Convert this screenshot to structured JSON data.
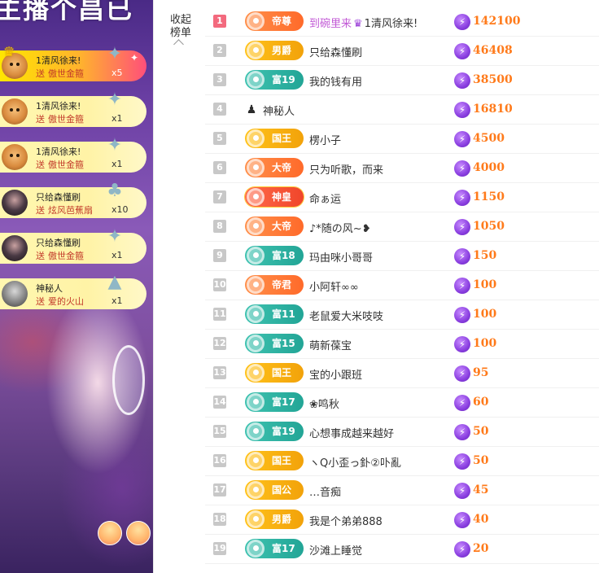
{
  "stream": {
    "title": "主播个昌已",
    "gifts": [
      {
        "user": "1清风徐来!",
        "verb": "送",
        "gift": "傲世金箍",
        "count": "x5",
        "avatar": "dog",
        "highlight": true
      },
      {
        "user": "1清风徐来!",
        "verb": "送",
        "gift": "傲世金箍",
        "count": "x1",
        "avatar": "dog",
        "highlight": false
      },
      {
        "user": "1清风徐来!",
        "verb": "送",
        "gift": "傲世金箍",
        "count": "x1",
        "avatar": "dog",
        "highlight": false
      },
      {
        "user": "只给森懂刷",
        "verb": "送",
        "gift": "炫风芭蕉扇",
        "count": "x10",
        "avatar": "dark",
        "highlight": false
      },
      {
        "user": "只给森懂刷",
        "verb": "送",
        "gift": "傲世金箍",
        "count": "x1",
        "avatar": "dark",
        "highlight": false
      },
      {
        "user": "神秘人",
        "verb": "送",
        "gift": "爱的火山",
        "count": "x1",
        "avatar": "spy",
        "highlight": false
      }
    ]
  },
  "panel": {
    "collapse_label": "收起榜单"
  },
  "ranking": [
    {
      "rank": "1",
      "badge": "帝尊",
      "badge_color": "orange",
      "name": "到碗里来",
      "name_suffix": "1清风徐来!",
      "score": "142100"
    },
    {
      "rank": "2",
      "badge": "男爵",
      "badge_color": "gold",
      "name": "只给森懂刷",
      "name_suffix": "",
      "score": "46408"
    },
    {
      "rank": "3",
      "badge": "富19",
      "badge_color": "teal",
      "name": "我的钱有用",
      "name_suffix": "",
      "score": "38500"
    },
    {
      "rank": "4",
      "badge": "",
      "badge_color": "",
      "name": "神秘人",
      "name_suffix": "",
      "score": "16810"
    },
    {
      "rank": "5",
      "badge": "国王",
      "badge_color": "gold",
      "name": "楞小子",
      "name_suffix": "",
      "score": "4500"
    },
    {
      "rank": "6",
      "badge": "大帝",
      "badge_color": "orange",
      "name": "只为听歌，而来",
      "name_suffix": "",
      "score": "4000"
    },
    {
      "rank": "7",
      "badge": "神皇",
      "badge_color": "red",
      "name": "命ぁ运",
      "name_suffix": "",
      "score": "1150"
    },
    {
      "rank": "8",
      "badge": "大帝",
      "badge_color": "orange",
      "name": "♪*随の风~❥",
      "name_suffix": "",
      "score": "1050"
    },
    {
      "rank": "9",
      "badge": "富18",
      "badge_color": "teal",
      "name": "玛由咪小哥哥",
      "name_suffix": "",
      "score": "150"
    },
    {
      "rank": "10",
      "badge": "帝君",
      "badge_color": "orange",
      "name": "小阿轩∞∞",
      "name_suffix": "",
      "score": "100"
    },
    {
      "rank": "11",
      "badge": "富11",
      "badge_color": "teal",
      "name": "老鼠爱大米吱吱",
      "name_suffix": "",
      "score": "100"
    },
    {
      "rank": "12",
      "badge": "富15",
      "badge_color": "teal",
      "name": "萌新葆宝",
      "name_suffix": "",
      "score": "100"
    },
    {
      "rank": "13",
      "badge": "国王",
      "badge_color": "gold",
      "name": "宝的小跟班",
      "name_suffix": "",
      "score": "95"
    },
    {
      "rank": "14",
      "badge": "富17",
      "badge_color": "teal",
      "name": "❀鸣秋",
      "name_suffix": "",
      "score": "60"
    },
    {
      "rank": "15",
      "badge": "富19",
      "badge_color": "teal",
      "name": "心想事成越来越好",
      "name_suffix": "",
      "score": "50"
    },
    {
      "rank": "16",
      "badge": "国王",
      "badge_color": "gold",
      "name": "ヽQ小歪っ釙②卟亂",
      "name_suffix": "",
      "score": "50"
    },
    {
      "rank": "17",
      "badge": "国公",
      "badge_color": "gold",
      "name": "…音痴",
      "name_suffix": "",
      "score": "45"
    },
    {
      "rank": "18",
      "badge": "男爵",
      "badge_color": "gold",
      "name": "我是个弟弟888",
      "name_suffix": "",
      "score": "40"
    },
    {
      "rank": "19",
      "badge": "富17",
      "badge_color": "teal",
      "name": "沙滩上睡觉",
      "name_suffix": "",
      "score": "20"
    }
  ],
  "colors": {
    "rank_top": "#f36a7e",
    "score": "#ff7a1a",
    "badge_orange": "#ff7a3a",
    "badge_gold": "#f5aa12",
    "badge_teal": "#2fb3a3",
    "noble_name": "#c25ad6"
  }
}
